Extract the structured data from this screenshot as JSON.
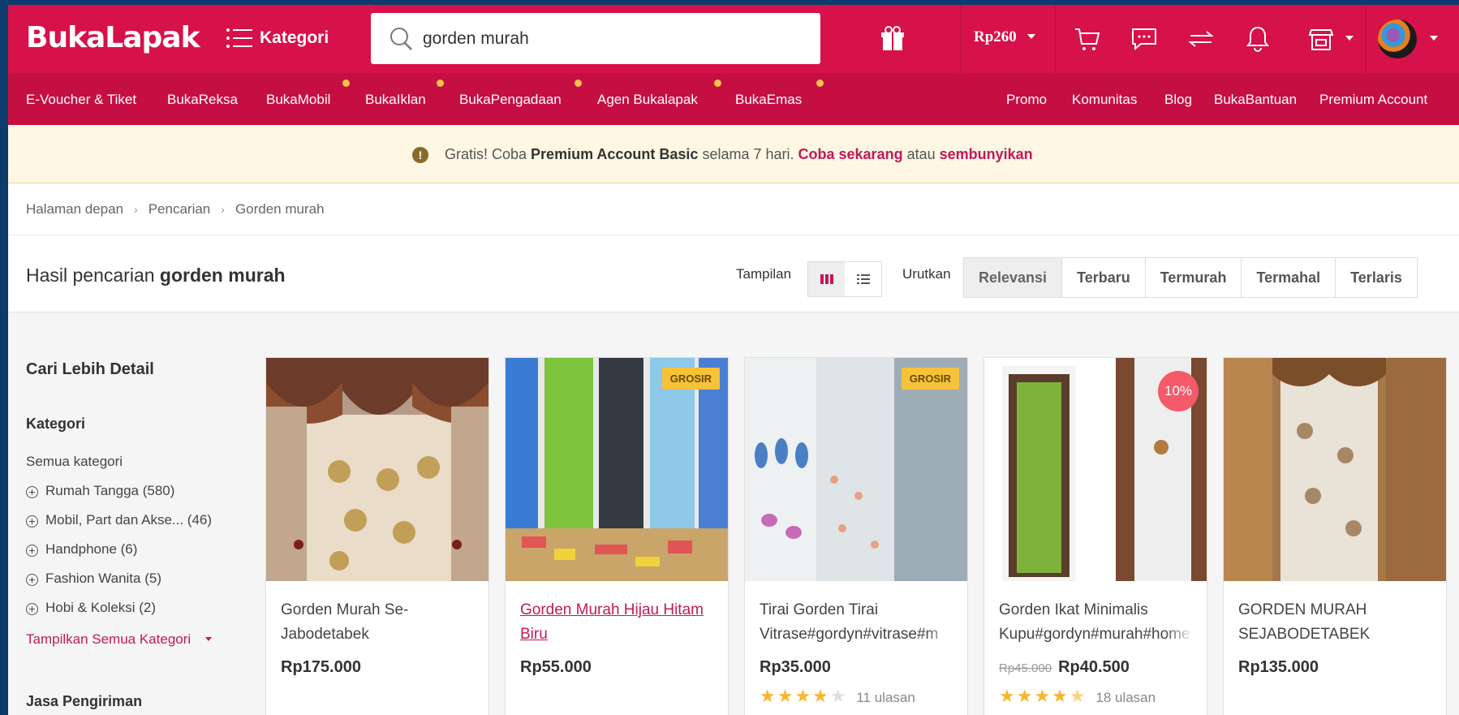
{
  "header": {
    "logo": "BukaLapak",
    "kategori_label": "Kategori",
    "search_value": "gorden murah",
    "balance": "Rp260"
  },
  "subnav": {
    "left": [
      "E-Voucher & Tiket",
      "BukaReksa",
      "BukaMobil",
      "BukaIklan",
      "BukaPengadaan",
      "Agen Bukalapak",
      "BukaEmas"
    ],
    "right": [
      "Promo",
      "Komunitas",
      "Blog",
      "BukaBantuan",
      "Premium Account"
    ]
  },
  "banner": {
    "part1": "Gratis! Coba ",
    "bold1": "Premium Account Basic",
    "part2": " selama 7 hari. ",
    "link1": "Coba sekarang",
    "part3": " atau ",
    "link2": "sembunyikan"
  },
  "breadcrumb": [
    "Halaman depan",
    "Pencarian",
    "Gorden murah"
  ],
  "results": {
    "prefix": "Hasil pencarian ",
    "query": "gorden murah",
    "tampilan": "Tampilan",
    "urutkan": "Urutkan",
    "sort": [
      "Relevansi",
      "Terbaru",
      "Termurah",
      "Termahal",
      "Terlaris"
    ]
  },
  "sidebar": {
    "title": "Cari Lebih Detail",
    "kategori_title": "Kategori",
    "all": "Semua kategori",
    "items": [
      "Rumah Tangga (580)",
      "Mobil, Part dan Akse... (46)",
      "Handphone (6)",
      "Fashion Wanita (5)",
      "Hobi & Koleksi (2)"
    ],
    "show_all": "Tampilkan Semua Kategori",
    "shipping_title": "Jasa Pengiriman"
  },
  "products": [
    {
      "name": "Gorden Murah Se-Jabodetabek",
      "price": "Rp175.000"
    },
    {
      "name": "Gorden Murah Hijau Hitam Biru",
      "price": "Rp55.000",
      "badge": "GROSIR"
    },
    {
      "name_l1": "Tirai Gorden Tirai",
      "name_l2": "Vitrase#gordyn#vitrase#m",
      "price": "Rp35.000",
      "badge": "GROSIR",
      "reviews": "11 ulasan",
      "rating": 4
    },
    {
      "name_l1": "Gorden Ikat Minimalis",
      "name_l2": "Kupu#gordyn#murah#home",
      "old_price": "Rp45.000",
      "price": "Rp40.500",
      "discount": "10%",
      "reviews": "18 ulasan",
      "rating": 4.5
    },
    {
      "name": "GORDEN MURAH SEJABODETABEK",
      "price": "Rp135.000"
    }
  ],
  "colors": {
    "brand": "#d71149",
    "subnav": "#c50f42",
    "link": "#c2185b",
    "badge": "#f6c239"
  }
}
